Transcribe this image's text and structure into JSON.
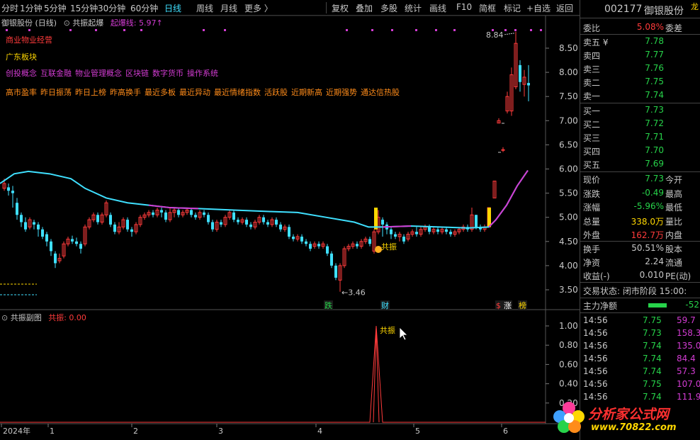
{
  "toolbar": {
    "periods": [
      "分时",
      "1分钟",
      "5分钟",
      "15分钟",
      "30分钟",
      "60分钟",
      "日线",
      "周线",
      "月线",
      "更多 〉"
    ],
    "active_period": "日线",
    "tools": [
      "复权",
      "叠加",
      "多股",
      "统计",
      "画线",
      "F10",
      "简框",
      "标记",
      "+自选",
      "返回"
    ]
  },
  "main_chart": {
    "title": "御银股份 (日线)",
    "indicator_name": "共振起爆",
    "indicator_line_label": "起爆线: 5.97↑",
    "concepts": {
      "line1": "商业物业经营",
      "line2": "广东板块",
      "line3": [
        "创投概念",
        "互联金融",
        "物业管理概念",
        "区块链",
        "数字货币",
        "操作系统"
      ],
      "line4": [
        "高市盈率",
        "昨日振荡",
        "昨日上榜",
        "昨高换手",
        "最近多板",
        "最近异动",
        "最近情绪指数",
        "活跃股",
        "近期新高",
        "近期强势",
        "通达信热股"
      ]
    },
    "high_label": "8.84",
    "low_label": "3.46",
    "signal_label": "共振",
    "price_axis": [
      "8.50",
      "8.00",
      "7.50",
      "7.00",
      "6.50",
      "6.00",
      "5.50",
      "5.00",
      "4.50",
      "4.00",
      "3.50"
    ],
    "event_tags": [
      {
        "text": "跌",
        "color": "#27d34a"
      },
      {
        "text": "财",
        "color": "#3fe0ff"
      },
      {
        "text": "$",
        "color": "#ff3b3b"
      },
      {
        "text": "涨",
        "color": "#ffffff"
      },
      {
        "text": "榜",
        "color": "#ffd700"
      }
    ]
  },
  "sub_chart": {
    "title": "共振副图",
    "value_label": "共振: 0.00",
    "signal_label": "共振",
    "axis": [
      "1.00",
      "0.80",
      "0.60",
      "0.40",
      "0.20"
    ]
  },
  "time_axis": [
    "2024年",
    "1",
    "2",
    "3",
    "4",
    "5",
    "6"
  ],
  "quote_panel": {
    "code": "002177",
    "name": "御银股份",
    "corner_tag": "龙",
    "weibi_label": "委比",
    "weibi_value": "5.08%",
    "weicha_label": "委差",
    "asks": [
      {
        "label": "卖五 ¥",
        "price": "7.78"
      },
      {
        "label": "卖四",
        "price": "7.77"
      },
      {
        "label": "卖三",
        "price": "7.76"
      },
      {
        "label": "卖二",
        "price": "7.75"
      },
      {
        "label": "卖一",
        "price": "7.74"
      }
    ],
    "bids": [
      {
        "label": "买一",
        "price": "7.73"
      },
      {
        "label": "买二",
        "price": "7.72"
      },
      {
        "label": "买三",
        "price": "7.71"
      },
      {
        "label": "买四",
        "price": "7.70"
      },
      {
        "label": "买五",
        "price": "7.69"
      }
    ],
    "stats": [
      {
        "label": "现价",
        "value": "7.73",
        "right": "今开",
        "color": "#27d34a"
      },
      {
        "label": "涨跌",
        "value": "-0.49",
        "right": "最高",
        "color": "#27d34a"
      },
      {
        "label": "涨幅",
        "value": "-5.96%",
        "right": "最低",
        "color": "#27d34a"
      },
      {
        "label": "总量",
        "value": "338.0万",
        "right": "量比",
        "color": "#ffd700"
      },
      {
        "label": "外盘",
        "value": "162.7万",
        "right": "内盘",
        "color": "#ff3b3b"
      }
    ],
    "stats2": [
      {
        "label": "换手",
        "value": "50.51%",
        "right": "股本"
      },
      {
        "label": "净资",
        "value": "2.24",
        "right": "流通"
      },
      {
        "label": "收益(-)",
        "value": "0.010",
        "right": "PE(动)"
      }
    ],
    "trade_status_label": "交易状态: 闭市阶段 15:00:",
    "main_flow_label": "主力净额",
    "main_flow_value": "-52",
    "ticks": [
      {
        "time": "14:56",
        "price": "7.75",
        "vol": "59.7"
      },
      {
        "time": "14:56",
        "price": "7.73",
        "vol": "158.3"
      },
      {
        "time": "14:56",
        "price": "7.74",
        "vol": "135.0"
      },
      {
        "time": "14:56",
        "price": "7.74",
        "vol": "84.4"
      },
      {
        "time": "14:56",
        "price": "7.74",
        "vol": "57.3"
      },
      {
        "time": "14:56",
        "price": "7.75",
        "vol": "107.0"
      },
      {
        "time": "14:56",
        "price": "7.74",
        "vol": "111.9"
      }
    ]
  },
  "watermark": {
    "brand": "分析家公式网",
    "url": "www.70822.com"
  }
}
